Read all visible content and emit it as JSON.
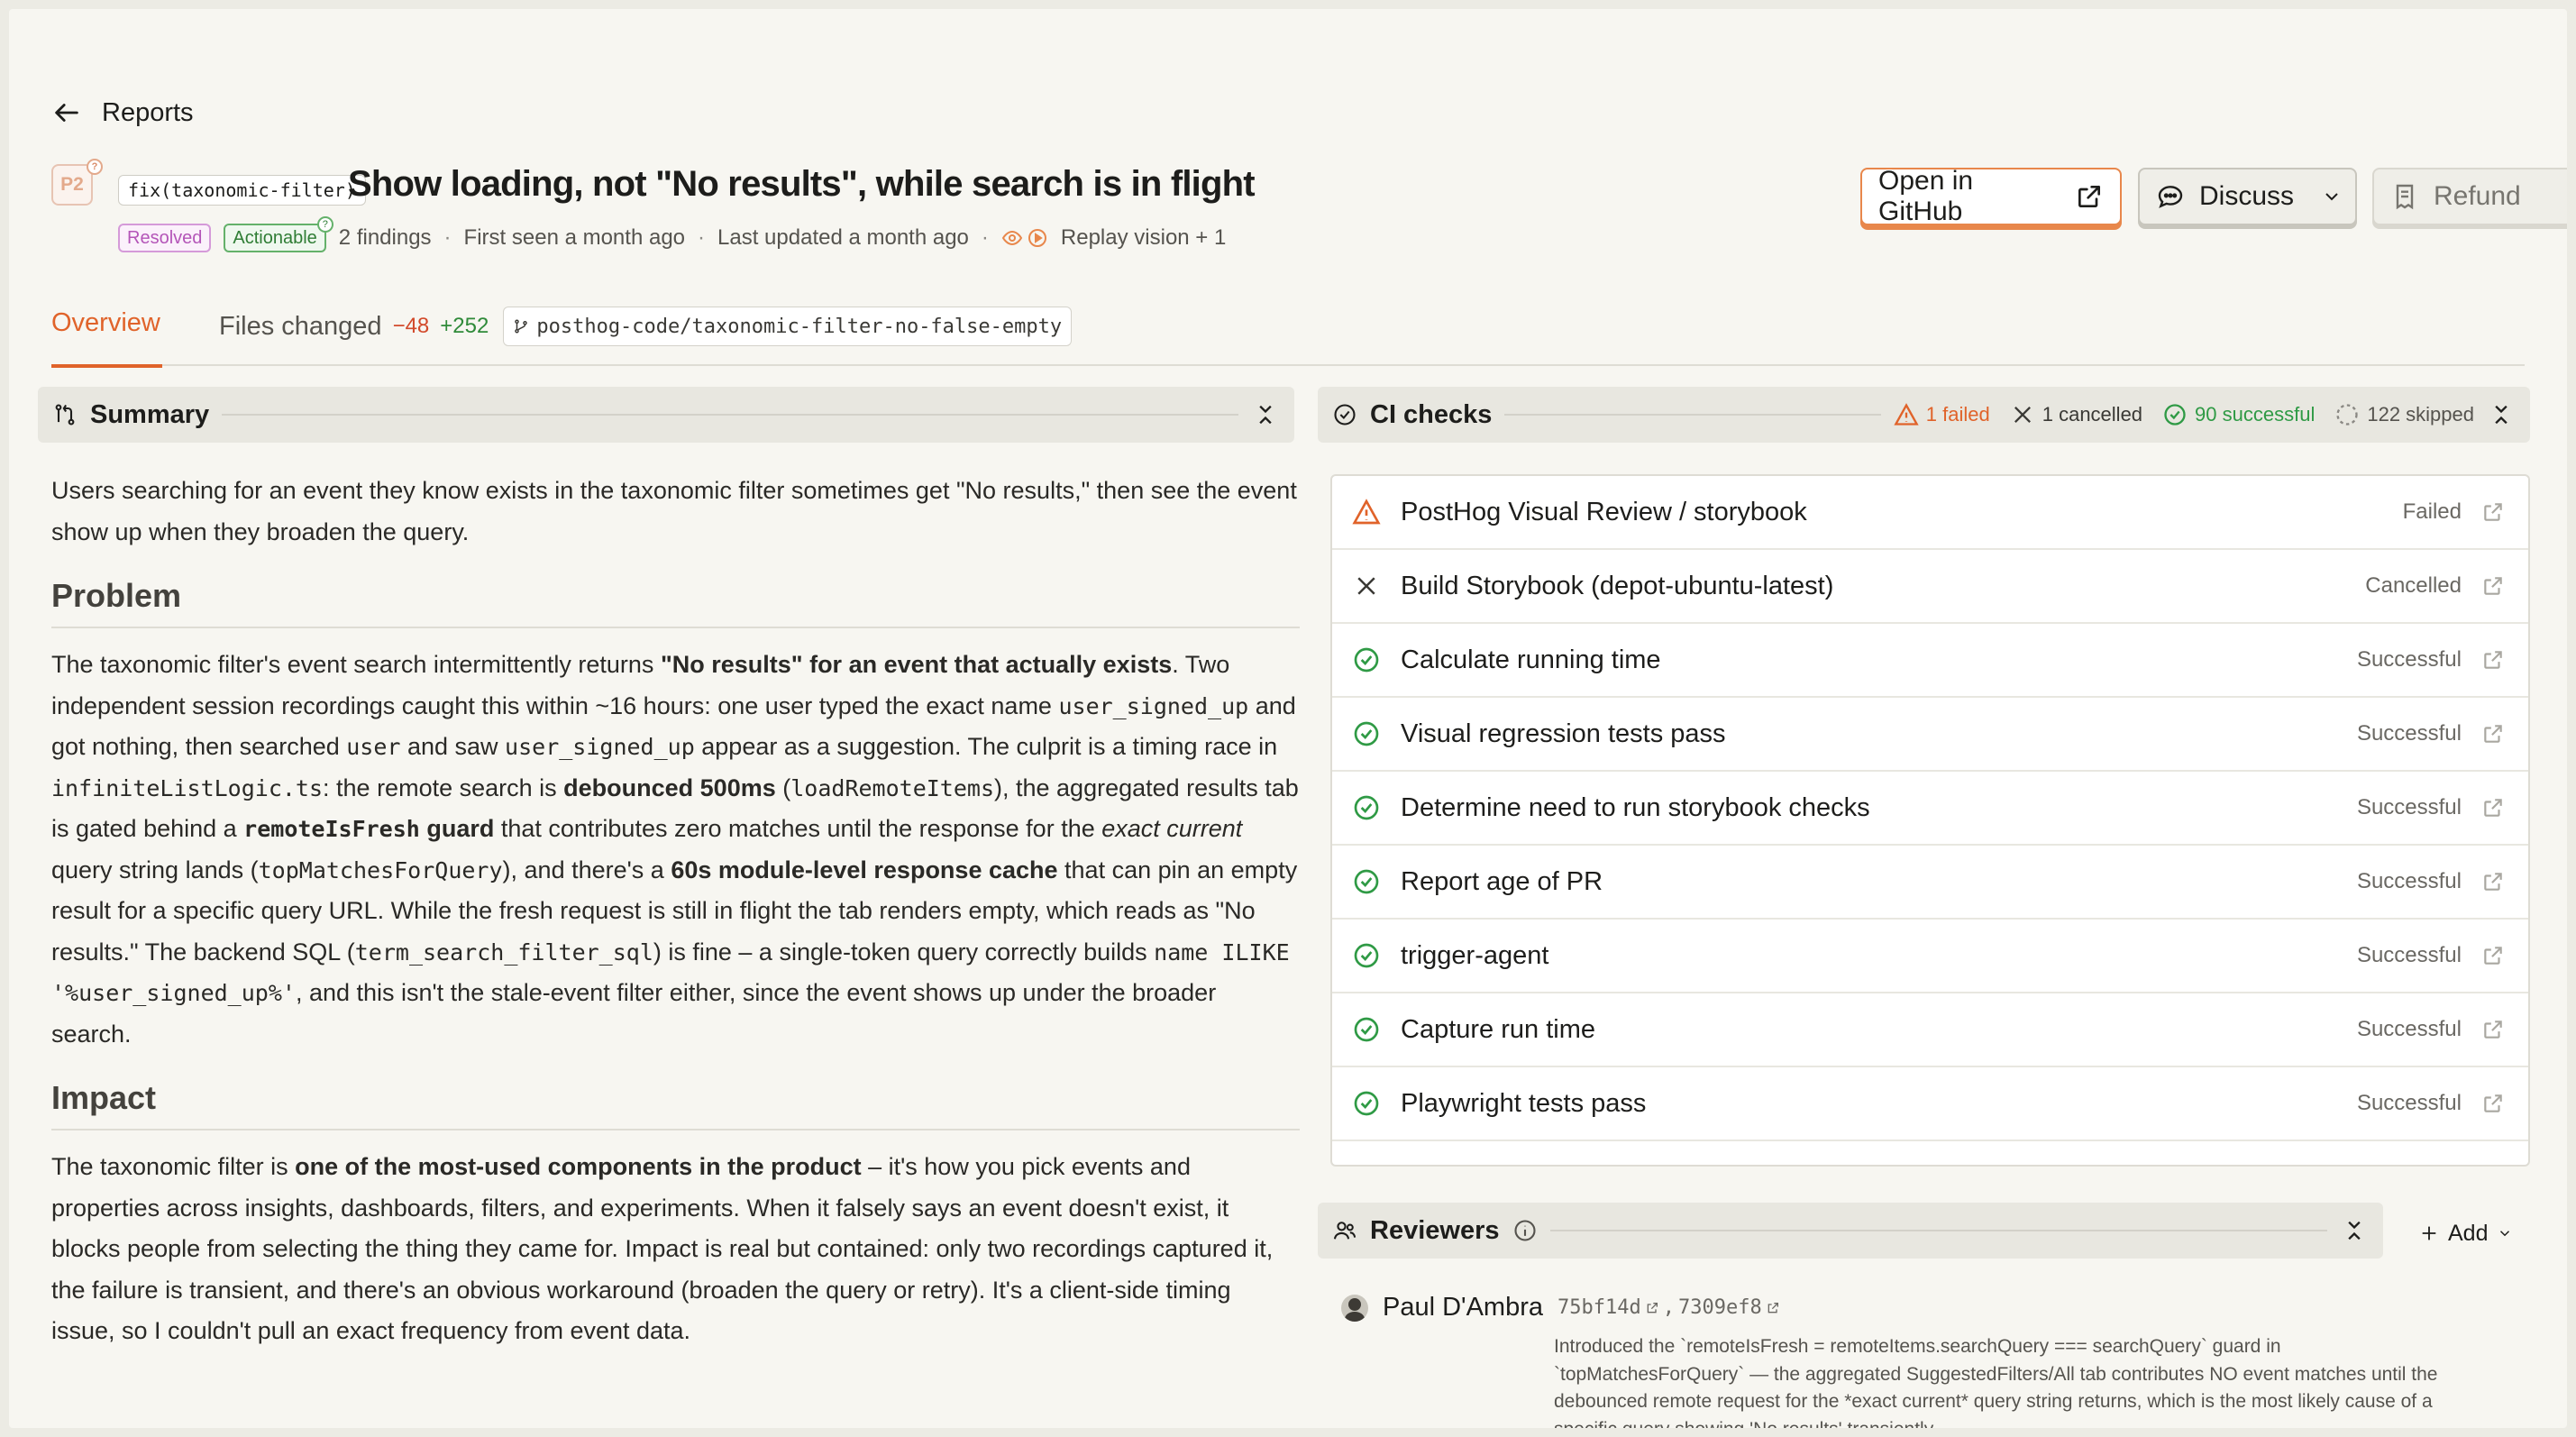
{
  "header": {
    "back_label": "Reports",
    "priority": "P2",
    "scope": "fix(taxonomic-filter)",
    "title": "Show loading, not \"No results\", while search is in flight",
    "status_badge": "Resolved",
    "actionable_badge": "Actionable",
    "findings": "2 findings",
    "first_seen": "First seen a month ago",
    "last_updated": "Last updated a month ago",
    "sources": "Replay vision + 1",
    "separator": "·",
    "buttons": {
      "github": "Open in GitHub",
      "discuss": "Discuss",
      "refund": "Refund"
    }
  },
  "tabs": {
    "overview": "Overview",
    "files_changed": "Files changed",
    "deletions": "−48",
    "additions": "+252",
    "branch": "posthog-code/taxonomic-filter-no-false-empty"
  },
  "summary": {
    "title": "Summary",
    "intro": "Users searching for an event they know exists in the taxonomic filter sometimes get \"No results,\" then see the event show up when they broaden the query.",
    "problem_heading": "Problem",
    "problem": {
      "t1": "The taxonomic filter's event search intermittently returns ",
      "b1": "\"No results\" for an event that actually exists",
      "t2": ". Two independent session recordings caught this within ~16 hours: one user typed the exact name ",
      "c1": "user_signed_up",
      "t3": " and got nothing, then searched ",
      "c2": "user",
      "t4": " and saw ",
      "c3": "user_signed_up",
      "t5": " appear as a suggestion. The culprit is a timing race in ",
      "c4": "infiniteListLogic.ts",
      "t6": ": the remote search is ",
      "b2": "debounced 500ms",
      "t7": " (",
      "c5": "loadRemoteItems",
      "t8": "), the aggregated results tab is gated behind a ",
      "c6": "remoteIsFresh",
      "b3": " guard",
      "t9": " that contributes zero matches until the response for the ",
      "i1": "exact current",
      "t10": " query string lands (",
      "c7": "topMatchesForQuery",
      "t11": "), and there's a ",
      "b4": "60s module-level response cache",
      "t12": " that can pin an empty result for a specific query URL. While the fresh request is still in flight the tab renders empty, which reads as \"No results.\" The backend SQL (",
      "c8": "term_search_filter_sql",
      "t13": ") is fine – a single-token query correctly builds ",
      "c9": "name ILIKE '%user_signed_up%'",
      "t14": ", and this isn't the stale-event filter either, since the event shows up under the broader search."
    },
    "impact_heading": "Impact",
    "impact": {
      "t1": "The taxonomic filter is ",
      "b1": "one of the most-used components in the product",
      "t2": " – it's how you pick events and properties across insights, dashboards, filters, and experiments. When it falsely says an event doesn't exist, it blocks people from selecting the thing they came for. Impact is real but contained: only two recordings captured it, the failure is transient, and there's an obvious workaround (broaden the query or retry). It's a client-side timing issue, so I couldn't pull an exact frequency from event data."
    }
  },
  "ci": {
    "title": "CI checks",
    "failed": "1 failed",
    "cancelled": "1 cancelled",
    "successful": "90 successful",
    "skipped": "122 skipped",
    "checks": [
      {
        "name": "PostHog Visual Review / storybook",
        "status": "Failed",
        "state": "failed"
      },
      {
        "name": "Build Storybook (depot-ubuntu-latest)",
        "status": "Cancelled",
        "state": "cancelled"
      },
      {
        "name": "Calculate running time",
        "status": "Successful",
        "state": "success"
      },
      {
        "name": "Visual regression tests pass",
        "status": "Successful",
        "state": "success"
      },
      {
        "name": "Determine need to run storybook checks",
        "status": "Successful",
        "state": "success"
      },
      {
        "name": "Report age of PR",
        "status": "Successful",
        "state": "success"
      },
      {
        "name": "trigger-agent",
        "status": "Successful",
        "state": "success"
      },
      {
        "name": "Capture run time",
        "status": "Successful",
        "state": "success"
      },
      {
        "name": "Playwright tests pass",
        "status": "Successful",
        "state": "success"
      }
    ],
    "colors": {
      "failed": "#e0632a",
      "success": "#2f9a45",
      "muted": "#6a6863"
    }
  },
  "reviewers": {
    "title": "Reviewers",
    "add_label": "Add",
    "items": [
      {
        "name": "Paul D'Ambra",
        "commit1": "75bf14d",
        "commit2": "7309ef8",
        "note": "Introduced the `remoteIsFresh = remoteItems.searchQuery === searchQuery` guard in `topMatchesForQuery` — the aggregated SuggestedFilters/All tab contributes NO event matches until the debounced remote request for the *exact current* query string returns, which is the most likely cause of a specific query showing 'No results' transiently."
      }
    ]
  }
}
